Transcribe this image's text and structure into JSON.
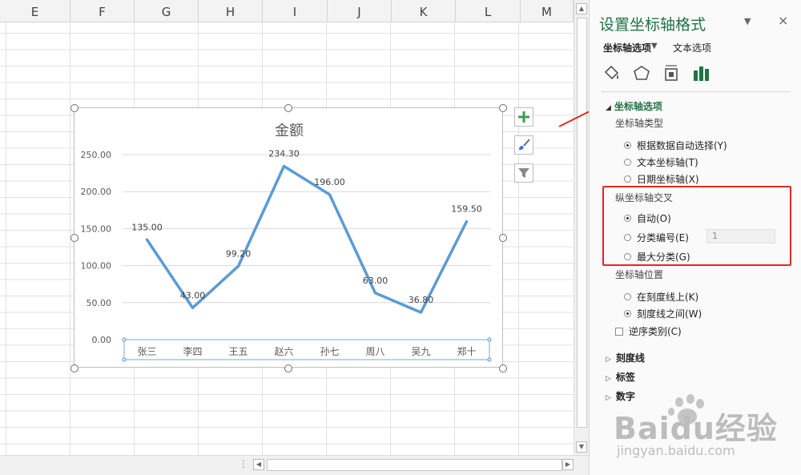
{
  "spreadsheet": {
    "columns": [
      "E",
      "F",
      "G",
      "H",
      "I",
      "J",
      "K",
      "L",
      "M"
    ]
  },
  "chart_data": {
    "type": "line",
    "title": "金额",
    "categories": [
      "张三",
      "李四",
      "王五",
      "赵六",
      "孙七",
      "周八",
      "吴九",
      "郑十"
    ],
    "values": [
      135.0,
      43.0,
      99.2,
      234.3,
      196.0,
      63.0,
      36.8,
      159.5
    ],
    "data_labels": [
      "135.00",
      "43.00",
      "99.20",
      "234.30",
      "196.00",
      "63.00",
      "36.80",
      "159.50"
    ],
    "y_ticks": [
      "0.00",
      "50.00",
      "100.00",
      "150.00",
      "200.00",
      "250.00"
    ],
    "ylim": [
      0,
      250
    ],
    "grid": true,
    "line_color": "#5b9bd5"
  },
  "chart_tools": {
    "add_icon": "plus-icon",
    "style_icon": "brush-icon",
    "filter_icon": "filter-icon"
  },
  "panel": {
    "title": "设置坐标轴格式",
    "tab_axis": "坐标轴选项",
    "tab_text": "文本选项",
    "close": "×",
    "section_axis_options": "坐标轴选项",
    "axis_type_label": "坐标轴类型",
    "axis_type_options": [
      "根据数据自动选择(Y)",
      "文本坐标轴(T)",
      "日期坐标轴(X)"
    ],
    "cross_label": "纵坐标轴交叉",
    "cross_options": [
      "自动(O)",
      "分类编号(E)",
      "最大分类(G)"
    ],
    "cross_value": "1",
    "position_label": "坐标轴位置",
    "position_options": [
      "在刻度线上(K)",
      "刻度线之间(W)"
    ],
    "reverse_label": "逆序类别(C)",
    "collapsed_sections": [
      "刻度线",
      "标签",
      "数字"
    ],
    "accent_color": "#217346"
  },
  "watermark": {
    "brand": "Baidu经验",
    "url": "jingyan.baidu.com"
  }
}
